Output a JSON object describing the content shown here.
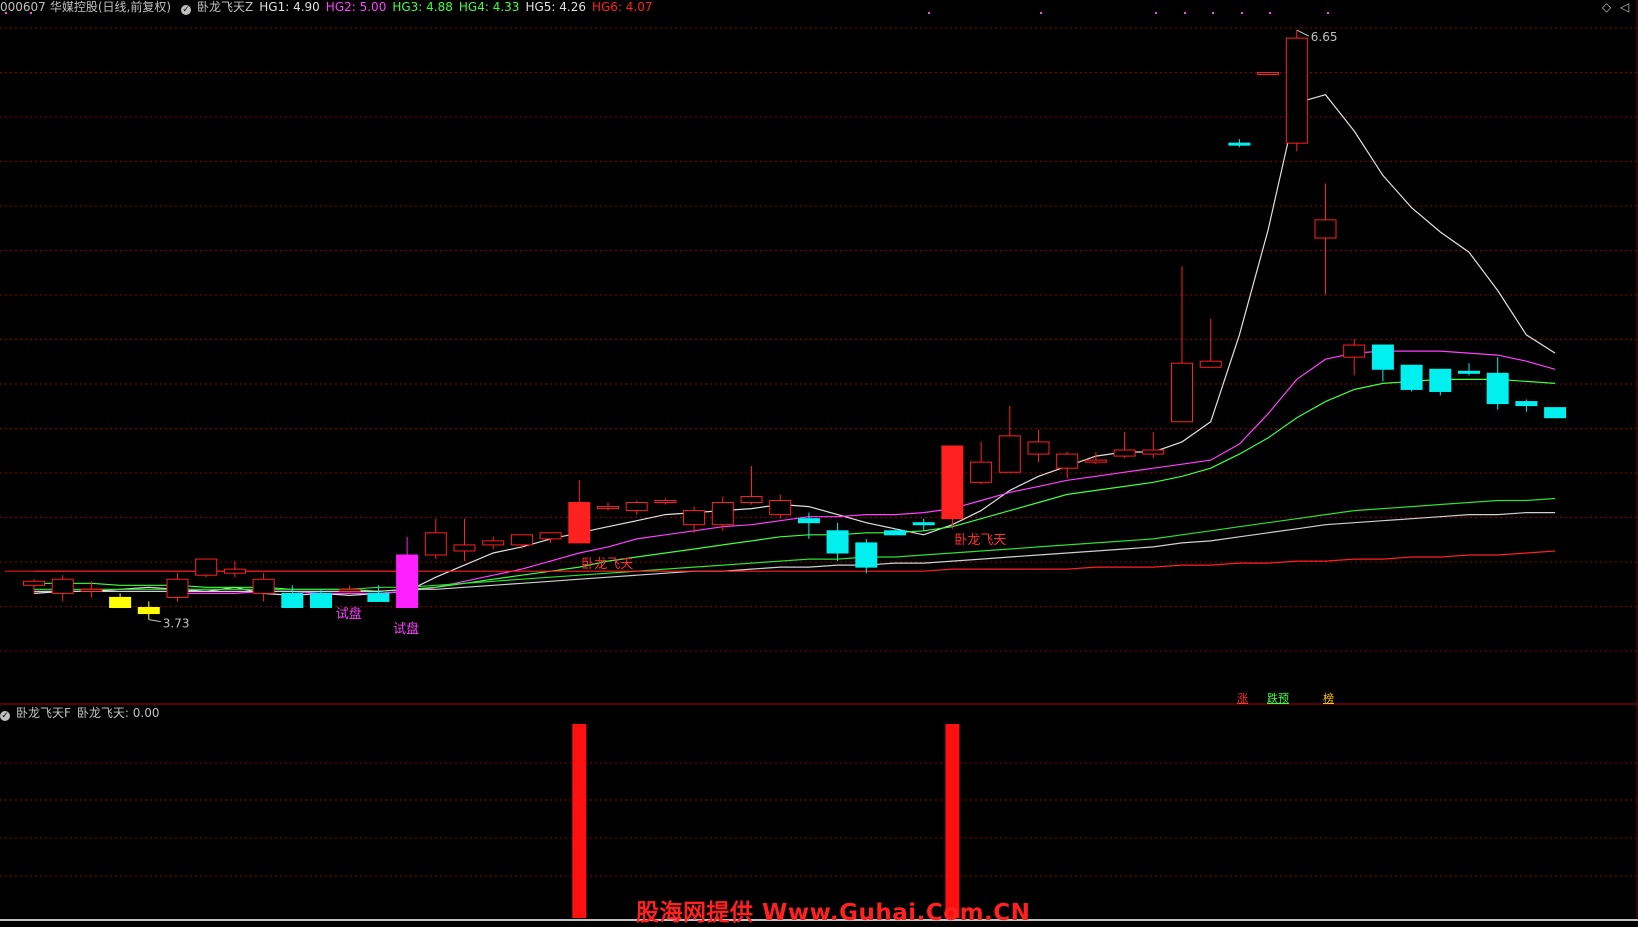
{
  "main_panel": {
    "stock_code": "000607",
    "stock_name": "华媒控股",
    "mode": "(日线,前复权)",
    "indicator_name": "卧龙飞天Z",
    "hg": [
      {
        "label": "HG1: 4.90",
        "color": "#e0e0e0"
      },
      {
        "label": "HG2: 5.00",
        "color": "#ff40ff"
      },
      {
        "label": "HG3: 4.88",
        "color": "#40ff40"
      },
      {
        "label": "HG4: 4.33",
        "color": "#40ff40"
      },
      {
        "label": "HG5: 4.26",
        "color": "#e0e0e0"
      },
      {
        "label": "HG6: 4.07",
        "color": "#ff2020"
      }
    ],
    "high_label": "6.65",
    "low_label": "3.73",
    "signal_texts": {
      "test": "试盘",
      "wolong": "卧龙飞天"
    },
    "bottom_tags": [
      {
        "text": "涨",
        "color": "#ff3030"
      },
      {
        "text": "跌预",
        "color": "#40ff40"
      },
      {
        "text": "榜",
        "color": "#ffc000"
      }
    ],
    "corner_icons": [
      "diamond-icon",
      "arrow-icon"
    ]
  },
  "sub_panel": {
    "indicator_name": "卧龙飞天F",
    "value_label": "卧龙飞天: 0.00"
  },
  "watermark": "股海网提供 Www.Guhai.Com.CN",
  "colors": {
    "up": "#ff2020",
    "down": "#00f0f0",
    "test_candle": "#ff20ff",
    "yellow_candle": "#ffff00",
    "grid": "#8a0000",
    "divider": "#b00000"
  },
  "chart_data": {
    "type": "candlestick",
    "candles": [
      {
        "o": 3.9,
        "h": 3.93,
        "l": 3.86,
        "c": 3.92
      },
      {
        "o": 3.86,
        "h": 3.95,
        "l": 3.82,
        "c": 3.93
      },
      {
        "o": 3.88,
        "h": 3.92,
        "l": 3.84,
        "c": 3.88
      },
      {
        "o": 3.84,
        "h": 3.86,
        "l": 3.8,
        "c": 3.79,
        "color": "#ffff00"
      },
      {
        "o": 3.79,
        "h": 3.82,
        "l": 3.73,
        "c": 3.76,
        "color": "#ffff00"
      },
      {
        "o": 3.84,
        "h": 3.96,
        "l": 3.82,
        "c": 3.93
      },
      {
        "o": 3.95,
        "h": 4.03,
        "l": 3.94,
        "c": 4.03
      },
      {
        "o": 3.96,
        "h": 4.02,
        "l": 3.94,
        "c": 3.98
      },
      {
        "o": 3.86,
        "h": 3.96,
        "l": 3.82,
        "c": 3.93
      },
      {
        "o": 3.86,
        "h": 3.9,
        "l": 3.8,
        "c": 3.79
      },
      {
        "o": 3.86,
        "h": 3.88,
        "l": 3.8,
        "c": 3.79
      },
      {
        "o": 3.88,
        "h": 3.9,
        "l": 3.86,
        "c": 3.88
      },
      {
        "o": 3.86,
        "h": 3.9,
        "l": 3.84,
        "c": 3.82
      },
      {
        "o": 3.79,
        "h": 4.14,
        "l": 3.79,
        "c": 4.05,
        "color": "#ff20ff"
      },
      {
        "o": 4.05,
        "h": 4.23,
        "l": 4.03,
        "c": 4.16
      },
      {
        "o": 4.07,
        "h": 4.23,
        "l": 4.02,
        "c": 4.1
      },
      {
        "o": 4.1,
        "h": 4.14,
        "l": 4.08,
        "c": 4.12
      },
      {
        "o": 4.1,
        "h": 4.15,
        "l": 4.08,
        "c": 4.15
      },
      {
        "o": 4.13,
        "h": 4.16,
        "l": 4.11,
        "c": 4.16
      },
      {
        "o": 4.11,
        "h": 4.42,
        "l": 4.11,
        "c": 4.31
      },
      {
        "o": 4.28,
        "h": 4.31,
        "l": 4.27,
        "c": 4.29
      },
      {
        "o": 4.27,
        "h": 4.32,
        "l": 4.25,
        "c": 4.31
      },
      {
        "o": 4.31,
        "h": 4.33,
        "l": 4.3,
        "c": 4.32
      },
      {
        "o": 4.2,
        "h": 4.29,
        "l": 4.16,
        "c": 4.27
      },
      {
        "o": 4.2,
        "h": 4.34,
        "l": 4.17,
        "c": 4.31
      },
      {
        "o": 4.31,
        "h": 4.49,
        "l": 4.3,
        "c": 4.34
      },
      {
        "o": 4.25,
        "h": 4.35,
        "l": 4.23,
        "c": 4.32
      },
      {
        "o": 4.23,
        "h": 4.26,
        "l": 4.13,
        "c": 4.21
      },
      {
        "o": 4.17,
        "h": 4.21,
        "l": 4.02,
        "c": 4.06
      },
      {
        "o": 4.11,
        "h": 4.13,
        "l": 3.96,
        "c": 3.99
      },
      {
        "o": 4.17,
        "h": 4.18,
        "l": 4.15,
        "c": 4.15
      },
      {
        "o": 4.21,
        "h": 4.23,
        "l": 4.17,
        "c": 4.2
      },
      {
        "o": 4.23,
        "h": 4.59,
        "l": 4.18,
        "c": 4.59
      },
      {
        "o": 4.41,
        "h": 4.61,
        "l": 4.4,
        "c": 4.51
      },
      {
        "o": 4.46,
        "h": 4.79,
        "l": 4.46,
        "c": 4.64
      },
      {
        "o": 4.55,
        "h": 4.67,
        "l": 4.51,
        "c": 4.61
      },
      {
        "o": 4.48,
        "h": 4.56,
        "l": 4.43,
        "c": 4.55
      },
      {
        "o": 4.51,
        "h": 4.56,
        "l": 4.5,
        "c": 4.52
      },
      {
        "o": 4.54,
        "h": 4.66,
        "l": 4.53,
        "c": 4.57
      },
      {
        "o": 4.55,
        "h": 4.66,
        "l": 4.53,
        "c": 4.57
      },
      {
        "o": 4.71,
        "h": 5.48,
        "l": 4.71,
        "c": 5.0
      },
      {
        "o": 4.98,
        "h": 5.22,
        "l": 4.98,
        "c": 5.01
      },
      {
        "o": 6.09,
        "h": 6.11,
        "l": 6.07,
        "c": 6.08
      },
      {
        "o": 6.44,
        "h": 6.44,
        "l": 6.44,
        "c": 6.44
      },
      {
        "o": 6.09,
        "h": 6.65,
        "l": 6.05,
        "c": 6.61
      },
      {
        "o": 5.62,
        "h": 5.89,
        "l": 5.34,
        "c": 5.71
      },
      {
        "o": 5.03,
        "h": 5.12,
        "l": 4.94,
        "c": 5.09
      },
      {
        "o": 5.09,
        "h": 5.03,
        "l": 4.91,
        "c": 4.97
      },
      {
        "o": 4.99,
        "h": 4.99,
        "l": 4.86,
        "c": 4.87
      },
      {
        "o": 4.97,
        "h": 4.97,
        "l": 4.84,
        "c": 4.86
      },
      {
        "o": 4.96,
        "h": 5.0,
        "l": 4.94,
        "c": 4.95
      },
      {
        "o": 4.95,
        "h": 5.03,
        "l": 4.77,
        "c": 4.8
      },
      {
        "o": 4.81,
        "h": 4.82,
        "l": 4.76,
        "c": 4.79
      },
      {
        "o": 4.78,
        "h": 4.78,
        "l": 4.73,
        "c": 4.73
      }
    ],
    "signals": [
      {
        "index": 11,
        "type": "test"
      },
      {
        "index": 13,
        "type": "test"
      },
      {
        "index": 19,
        "type": "wolong"
      },
      {
        "index": 32,
        "type": "wolong"
      }
    ],
    "ma_lines": [
      {
        "color": "#e0e0e0",
        "values": [
          3.86,
          3.87,
          3.87,
          3.88,
          3.89,
          3.88,
          3.87,
          3.89,
          3.86,
          3.85,
          3.86,
          3.85,
          3.86,
          3.87,
          3.94,
          4.0,
          4.06,
          4.09,
          4.13,
          4.16,
          4.19,
          4.22,
          4.25,
          4.26,
          4.27,
          4.28,
          4.3,
          4.29,
          4.25,
          4.21,
          4.18,
          4.15,
          4.2,
          4.27,
          4.37,
          4.44,
          4.49,
          4.54,
          4.56,
          4.56,
          4.61,
          4.71,
          5.14,
          5.66,
          6.29,
          6.33,
          6.15,
          5.93,
          5.77,
          5.65,
          5.55,
          5.36,
          5.14,
          5.05
        ]
      },
      {
        "color": "#ff40ff",
        "values": [
          null,
          null,
          null,
          null,
          null,
          3.86,
          3.86,
          3.86,
          3.87,
          3.87,
          3.86,
          3.86,
          3.86,
          3.87,
          3.89,
          3.92,
          3.95,
          3.98,
          4.02,
          4.06,
          4.09,
          4.13,
          4.15,
          4.17,
          4.19,
          4.2,
          4.22,
          4.24,
          4.24,
          4.25,
          4.25,
          4.26,
          4.28,
          4.32,
          4.36,
          4.39,
          4.42,
          4.44,
          4.46,
          4.48,
          4.5,
          4.52,
          4.6,
          4.75,
          4.92,
          5.02,
          5.05,
          5.06,
          5.06,
          5.06,
          5.05,
          5.04,
          5.01,
          4.97
        ]
      },
      {
        "color": "#40ff40",
        "values": [
          3.91,
          3.91,
          3.91,
          3.9,
          3.9,
          3.9,
          3.89,
          3.89,
          3.89,
          3.88,
          3.88,
          3.88,
          3.87,
          3.88,
          3.89,
          3.91,
          3.93,
          3.95,
          3.97,
          3.99,
          4.02,
          4.04,
          4.06,
          4.08,
          4.1,
          4.12,
          4.14,
          4.15,
          4.15,
          4.16,
          4.16,
          4.17,
          4.19,
          4.23,
          4.27,
          4.31,
          4.35,
          4.37,
          4.39,
          4.41,
          4.44,
          4.48,
          4.55,
          4.63,
          4.73,
          4.81,
          4.87,
          4.9,
          4.91,
          4.92,
          4.92,
          4.92,
          4.91,
          4.9
        ]
      },
      {
        "color": "#2ee02e",
        "values": [
          3.88,
          3.88,
          3.88,
          3.88,
          3.88,
          3.88,
          3.88,
          3.88,
          3.88,
          3.88,
          3.88,
          3.88,
          3.89,
          3.89,
          3.9,
          3.91,
          3.92,
          3.93,
          3.94,
          3.95,
          3.96,
          3.97,
          3.98,
          3.99,
          4.0,
          4.01,
          4.02,
          4.03,
          4.03,
          4.04,
          4.04,
          4.05,
          4.06,
          4.07,
          4.08,
          4.09,
          4.1,
          4.11,
          4.12,
          4.13,
          4.15,
          4.17,
          4.19,
          4.21,
          4.23,
          4.25,
          4.27,
          4.28,
          4.29,
          4.3,
          4.31,
          4.32,
          4.32,
          4.33
        ]
      },
      {
        "color": "#d0d0d0",
        "values": [
          3.87,
          3.87,
          3.87,
          3.87,
          3.87,
          3.87,
          3.87,
          3.87,
          3.87,
          3.87,
          3.87,
          3.87,
          3.87,
          3.88,
          3.88,
          3.89,
          3.9,
          3.91,
          3.92,
          3.93,
          3.94,
          3.95,
          3.96,
          3.97,
          3.97,
          3.98,
          3.99,
          3.99,
          4.0,
          4.0,
          4.01,
          4.01,
          4.02,
          4.03,
          4.04,
          4.05,
          4.06,
          4.07,
          4.08,
          4.09,
          4.11,
          4.12,
          4.14,
          4.16,
          4.18,
          4.2,
          4.21,
          4.22,
          4.23,
          4.24,
          4.25,
          4.25,
          4.26,
          4.26
        ]
      },
      {
        "color": "#ff2020",
        "values": [
          3.97,
          3.97,
          3.97,
          3.97,
          3.97,
          3.97,
          3.97,
          3.97,
          3.97,
          3.97,
          3.97,
          3.97,
          3.97,
          3.97,
          3.97,
          3.97,
          3.97,
          3.97,
          3.97,
          3.97,
          3.97,
          3.97,
          3.97,
          3.97,
          3.97,
          3.97,
          3.97,
          3.97,
          3.97,
          3.97,
          3.97,
          3.97,
          3.98,
          3.98,
          3.98,
          3.98,
          3.98,
          3.99,
          3.99,
          3.99,
          4.0,
          4.0,
          4.01,
          4.01,
          4.02,
          4.02,
          4.03,
          4.03,
          4.04,
          4.04,
          4.05,
          4.05,
          4.06,
          4.07
        ]
      }
    ],
    "sub_indicator_values_nonzero": [
      {
        "index": 19,
        "value": 1
      },
      {
        "index": 32,
        "value": 1
      }
    ]
  }
}
